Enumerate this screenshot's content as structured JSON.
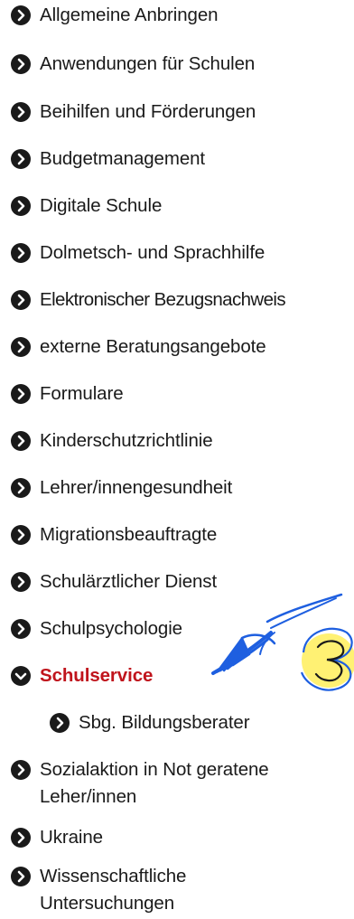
{
  "menu": {
    "items": [
      {
        "label": "Allgemeine Anbringen",
        "icon": "chevron-right-circle-icon"
      },
      {
        "label": "Anwendungen für Schulen",
        "icon": "chevron-right-circle-icon"
      },
      {
        "label": "Beihilfen und Förderungen",
        "icon": "chevron-right-circle-icon"
      },
      {
        "label": "Budgetmanagement",
        "icon": "chevron-right-circle-icon"
      },
      {
        "label": "Digitale Schule",
        "icon": "chevron-right-circle-icon"
      },
      {
        "label": "Dolmetsch- und Sprachhilfe",
        "icon": "chevron-right-circle-icon"
      },
      {
        "label": "Elektronischer Bezugsnachweis",
        "icon": "chevron-right-circle-icon"
      },
      {
        "label": "externe Beratungsangebote",
        "icon": "chevron-right-circle-icon"
      },
      {
        "label": "Formulare",
        "icon": "chevron-right-circle-icon"
      },
      {
        "label": "Kinderschutzrichtlinie",
        "icon": "chevron-right-circle-icon"
      },
      {
        "label": "Lehrer/innengesundheit",
        "icon": "chevron-right-circle-icon"
      },
      {
        "label": "Migrationsbeauftragte",
        "icon": "chevron-right-circle-icon"
      },
      {
        "label": "Schulärztlicher Dienst",
        "icon": "chevron-right-circle-icon"
      },
      {
        "label": "Schulpsychologie",
        "icon": "chevron-right-circle-icon"
      },
      {
        "label": "Schulservice",
        "icon": "chevron-down-circle-icon",
        "active": true
      },
      {
        "label": "Sbg. Bildungsberater",
        "icon": "chevron-right-circle-icon",
        "level": 2
      },
      {
        "label": "Sozialaktion in Not geratene Leher/innen",
        "icon": "chevron-right-circle-icon"
      },
      {
        "label": "Ukraine",
        "icon": "chevron-right-circle-icon"
      },
      {
        "label": "Wissenschaftliche Untersuchungen",
        "icon": "chevron-right-circle-icon"
      }
    ]
  },
  "colors": {
    "text": "#1a1a1a",
    "icon": "#1a1a1a",
    "active": "#c0141c",
    "annotation_blue": "#1e5fe0",
    "annotation_yellow": "#ffe600"
  },
  "annotation": {
    "handwritten_number": "3"
  }
}
